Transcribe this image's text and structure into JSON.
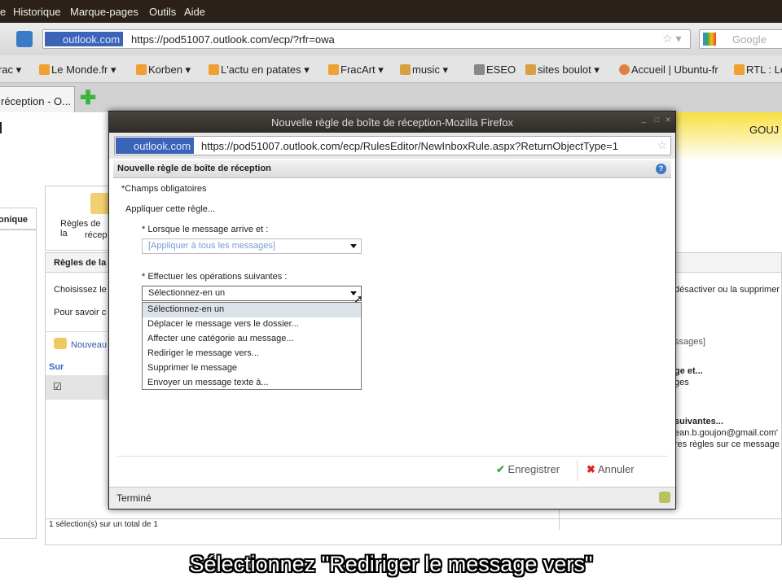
{
  "menubar": {
    "items": [
      "e",
      "Historique",
      "Marque-pages",
      "Outils",
      "Aide"
    ]
  },
  "navbar": {
    "site": "outlook.com",
    "url": "https://pod51007.outlook.com/ecp/?rfr=owa",
    "search_placeholder": "Google"
  },
  "bookmarks": [
    "rac ▾",
    "Le Monde.fr ▾",
    "Korben ▾",
    "L'actu en patates ▾",
    "FracArt ▾",
    "music ▾",
    "ESEO",
    "sites boulot ▾",
    "Accueil | Ubuntu-fr",
    "RTL : Le"
  ],
  "tabs": {
    "active": "réception - O..."
  },
  "background": {
    "header_user": "GOUJ",
    "sidebar_item": "onique",
    "rules_icon_label_1": "Règles de la",
    "rules_icon_label_2": "récep",
    "panel_title": "Règles de la",
    "choose_text": "Choisissez le",
    "learn_text": "Pour savoir c",
    "new_button": "Nouveau",
    "col_on": "Sur",
    "right_text_1": "désactiver ou la supprimer",
    "right_text_2": "ssages]",
    "right_text_3": "ge et...",
    "right_text_4": "ges",
    "right_text_5": "suivantes...",
    "right_text_6": "ean.b.goujon@gmail.com'",
    "right_text_7": "res règles sur ce message",
    "status": "1 sélection(s) sur un total de 1"
  },
  "dialog": {
    "window_title": "Nouvelle règle de boîte de réception-Mozilla Firefox",
    "site": "outlook.com",
    "url": "https://pod51007.outlook.com/ecp/RulesEditor/NewInboxRule.aspx?ReturnObjectType=1",
    "header": "Nouvelle règle de boîte de réception",
    "required_note": "*Champs obligatoires",
    "apply_label": "Appliquer cette règle...",
    "condition_label": "* Lorsque le message arrive et :",
    "condition_value": "[Appliquer à tous les messages]",
    "action_label": "* Effectuer les opérations suivantes :",
    "action_value": "Sélectionnez-en un",
    "action_options": [
      "Sélectionnez-en un",
      "Déplacer le message vers le dossier...",
      "Affecter une catégorie au message...",
      "Rediriger le message vers...",
      "Supprimer le message",
      "Envoyer un message texte à..."
    ],
    "save_label": "Enregistrer",
    "cancel_label": "Annuler",
    "status": "Terminé"
  },
  "subtitle": "Sélectionnez \"Rediriger le message vers\""
}
